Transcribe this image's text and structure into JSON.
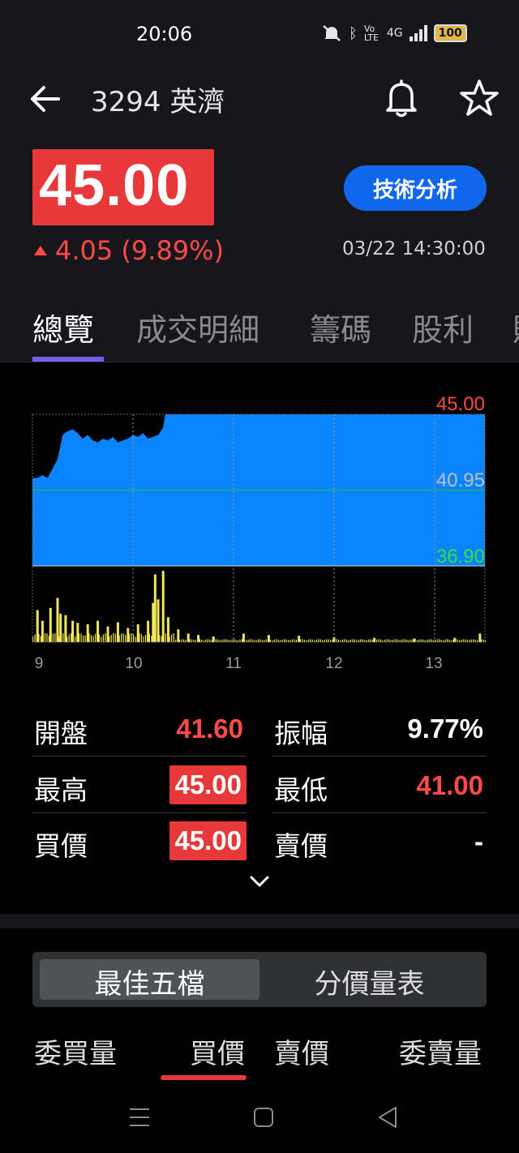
{
  "status_bar": {
    "time": "20:06",
    "network": "4G",
    "volte": "Vo LTE",
    "battery": "100"
  },
  "header": {
    "title": "3294 英濟"
  },
  "quote": {
    "price": "45.00",
    "change": "4.05 (9.89%)",
    "timestamp": "03/22 14:30:00",
    "tech_button": "技術分析"
  },
  "tabs": [
    "總覽",
    "成交明細",
    "籌碼",
    "股利",
    "財"
  ],
  "chart_data": {
    "type": "area",
    "price_axis": {
      "high": "45.00",
      "mid": "40.95",
      "low": "36.90",
      "ylim": [
        36.9,
        45.0
      ]
    },
    "x_ticks": [
      "9",
      "10",
      "11",
      "12",
      "13"
    ],
    "price_series": [
      {
        "t": 9.0,
        "p": 41.6
      },
      {
        "t": 9.05,
        "p": 41.6
      },
      {
        "t": 9.1,
        "p": 41.75
      },
      {
        "t": 9.15,
        "p": 41.6
      },
      {
        "t": 9.2,
        "p": 42.1
      },
      {
        "t": 9.25,
        "p": 42.6
      },
      {
        "t": 9.3,
        "p": 43.9
      },
      {
        "t": 9.35,
        "p": 44.1
      },
      {
        "t": 9.4,
        "p": 44.2
      },
      {
        "t": 9.45,
        "p": 44.0
      },
      {
        "t": 9.5,
        "p": 43.7
      },
      {
        "t": 9.55,
        "p": 43.9
      },
      {
        "t": 9.6,
        "p": 43.6
      },
      {
        "t": 9.65,
        "p": 43.5
      },
      {
        "t": 9.7,
        "p": 43.7
      },
      {
        "t": 9.75,
        "p": 43.6
      },
      {
        "t": 9.8,
        "p": 43.8
      },
      {
        "t": 9.85,
        "p": 43.5
      },
      {
        "t": 9.9,
        "p": 43.6
      },
      {
        "t": 9.95,
        "p": 43.7
      },
      {
        "t": 10.0,
        "p": 43.9
      },
      {
        "t": 10.05,
        "p": 43.8
      },
      {
        "t": 10.1,
        "p": 44.0
      },
      {
        "t": 10.15,
        "p": 43.7
      },
      {
        "t": 10.2,
        "p": 43.8
      },
      {
        "t": 10.25,
        "p": 43.9
      },
      {
        "t": 10.3,
        "p": 44.3
      },
      {
        "t": 10.32,
        "p": 45.0
      },
      {
        "t": 13.5,
        "p": 45.0
      }
    ],
    "volume_series": [
      {
        "t": 9.05,
        "v": 0.45
      },
      {
        "t": 9.1,
        "v": 0.3
      },
      {
        "t": 9.18,
        "v": 0.48
      },
      {
        "t": 9.25,
        "v": 0.62
      },
      {
        "t": 9.28,
        "v": 0.4
      },
      {
        "t": 9.33,
        "v": 0.38
      },
      {
        "t": 9.4,
        "v": 0.3
      },
      {
        "t": 9.45,
        "v": 0.27
      },
      {
        "t": 9.55,
        "v": 0.25
      },
      {
        "t": 9.65,
        "v": 0.3
      },
      {
        "t": 9.75,
        "v": 0.22
      },
      {
        "t": 9.85,
        "v": 0.28
      },
      {
        "t": 9.95,
        "v": 0.2
      },
      {
        "t": 10.05,
        "v": 0.25
      },
      {
        "t": 10.15,
        "v": 0.3
      },
      {
        "t": 10.2,
        "v": 0.55
      },
      {
        "t": 10.22,
        "v": 0.95
      },
      {
        "t": 10.25,
        "v": 0.6
      },
      {
        "t": 10.3,
        "v": 1.0
      },
      {
        "t": 10.35,
        "v": 0.35
      },
      {
        "t": 10.45,
        "v": 0.18
      },
      {
        "t": 10.55,
        "v": 0.12
      },
      {
        "t": 10.65,
        "v": 0.1
      },
      {
        "t": 10.8,
        "v": 0.08
      },
      {
        "t": 11.1,
        "v": 0.12
      },
      {
        "t": 11.35,
        "v": 0.1
      },
      {
        "t": 11.65,
        "v": 0.09
      },
      {
        "t": 12.0,
        "v": 0.07
      },
      {
        "t": 12.4,
        "v": 0.06
      },
      {
        "t": 12.8,
        "v": 0.05
      },
      {
        "t": 13.2,
        "v": 0.06
      },
      {
        "t": 13.45,
        "v": 0.12
      }
    ],
    "colors": {
      "price_fill": "#0a84ff",
      "volume": "#f0e65a",
      "high": "#ff4a4a",
      "mid": "#bfbfbf",
      "low": "#3ddc3d"
    }
  },
  "stats": {
    "open_label": "開盤",
    "open_value": "41.60",
    "amp_label": "振幅",
    "amp_value": "9.77%",
    "high_label": "最高",
    "high_value": "45.00",
    "low_label": "最低",
    "low_value": "41.00",
    "bid_label": "買價",
    "bid_value": "45.00",
    "ask_label": "賣價",
    "ask_value": "-"
  },
  "order_book": {
    "seg_best5": "最佳五檔",
    "seg_volume_table": "分價量表",
    "col_bid_qty": "委買量",
    "col_bid": "買價",
    "col_ask": "賣價",
    "col_ask_qty": "委賣量"
  }
}
